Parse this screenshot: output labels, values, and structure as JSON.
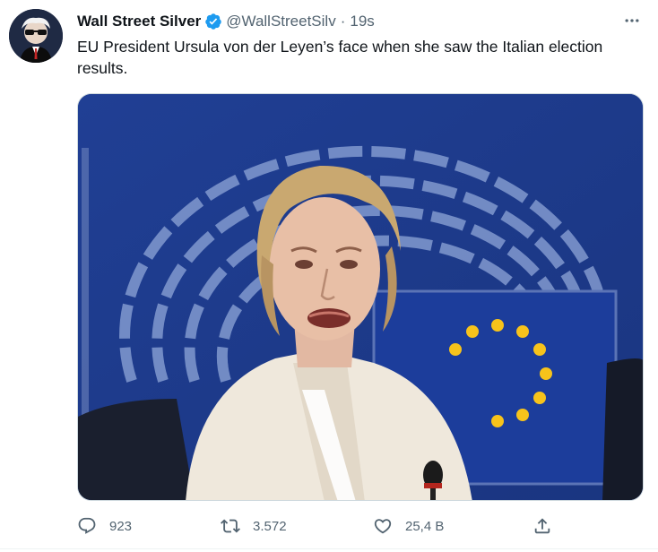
{
  "author": {
    "display_name": "Wall Street Silver",
    "handle": "@WallStreetSilv",
    "separator": "·",
    "time": "19s",
    "avatar_icon": "avatar-icon",
    "verified_icon": "verified-badge-icon"
  },
  "tweet": {
    "text": "EU President Ursula von der Leyen’s face when she saw the Italian election results."
  },
  "media": {
    "kind": "photo"
  },
  "actions": {
    "reply_count": "923",
    "retweet_count": "3.572",
    "like_count": "25,4 B",
    "reply_icon": "reply-icon",
    "retweet_icon": "retweet-icon",
    "like_icon": "heart-icon",
    "share_icon": "share-icon"
  },
  "colors": {
    "text": "#0f1419",
    "muted": "#536471",
    "verified": "#1d9bf0",
    "eu_blue": "#1f3f96",
    "eu_star": "#f7c31b"
  }
}
